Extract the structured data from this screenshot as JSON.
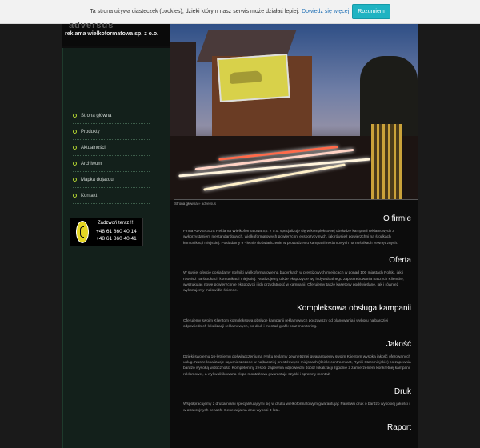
{
  "cookie": {
    "text": "Ta strona używa ciasteczek (cookies), dzięki którym nasz serwis może działać lepiej.",
    "link_label": "Dowiedz się więcej",
    "button_label": "Rozumiem"
  },
  "logo": {
    "top": "adversus",
    "text": "reklama wielkoformatowa sp. z o.o."
  },
  "menu": {
    "items": [
      {
        "label": "Strona główna"
      },
      {
        "label": "Produkty"
      },
      {
        "label": "Aktualności"
      },
      {
        "label": "Archiwum"
      },
      {
        "label": "Mapka dojazdu"
      },
      {
        "label": "Kontakt"
      }
    ]
  },
  "call": {
    "title": "Zadzwoń teraz !!!",
    "phone1": "+48 61 860 40 14",
    "phone2": "+48 61 860 40 41"
  },
  "breadcrumb": {
    "home": "Strona główna",
    "separator": " » ",
    "current": "adversus"
  },
  "sections": [
    {
      "title": "O firmie",
      "body": "Firma ADVERSUS Reklama Wielkoformatowa Sp. z o.o. specjalizuje się w kompleksowej obsłudze kampanii reklamowych z wykorzystaniem niestandardowych, wielkoformatowych powierzchni ekspozycyjnych, jak również powierzchni na środkach komunikacji miejskiej. Posiadamy 9 - letnie doświadczenie w prowadzeniu kampanii reklamowych na nośnikach zewnętrznych."
    },
    {
      "title": "Oferta",
      "body": "W swojej ofercie posiadamy nośniki wielkoformatowe na budynkach w prestiżowych miejscach w ponad 100 miastach Polski, jak i również na środkach komunikacji miejskiej. Realizujemy także ekspozycje wg indywidualnego zapotrzebowania naszych Klientów, wyszukując nowe powierzchnie ekspozycji i ich przydatność w kampanii. Oferujemy także kasetony podświetlane, jak i również wykonujemy malowidła ścienne."
    },
    {
      "title": "Kompleksowa obsługa kampanii",
      "body": "Oferujemy swoim Klientom kompleksową obsługę kampanii reklamowych począwszy od planowania i wyboru najbardziej odpowiednich lokalizacji reklamowych, po druk i montaż grafik oraz monitoring."
    },
    {
      "title": "Jakość",
      "body": "Dzięki swojemu 16-letniemu doświadczeniu na rynku reklamy zewnętrznej gwarantujemy swoim Klientom wysoką jakość oferowanych usług. Nasze lokalizacje są umieszczone w najbardziej prestiżowych miejscach (ścisłe centra miast, Rynki Staromiejskie) co zapewnia bardzo wysoką widoczność. Kompetentny zespół zapewnia odpowiedni dobór lokalizacji zgodnie z zamierzeniem konkretnej kampanii reklamowej, a wykwalifikowana ekipa montażowa gwarantuje szybki i sprawny montaż."
    },
    {
      "title": "Druk",
      "body": "Współpracujemy z drukarniami specjalizującymi się w druku wielkoformatowym gwarantując Państwu druk o bardzo wysokiej jakości i w atrakcyjnych cenach. Generacja na druk wynosi 3 lata."
    },
    {
      "title": "Raport",
      "body": ""
    }
  ]
}
